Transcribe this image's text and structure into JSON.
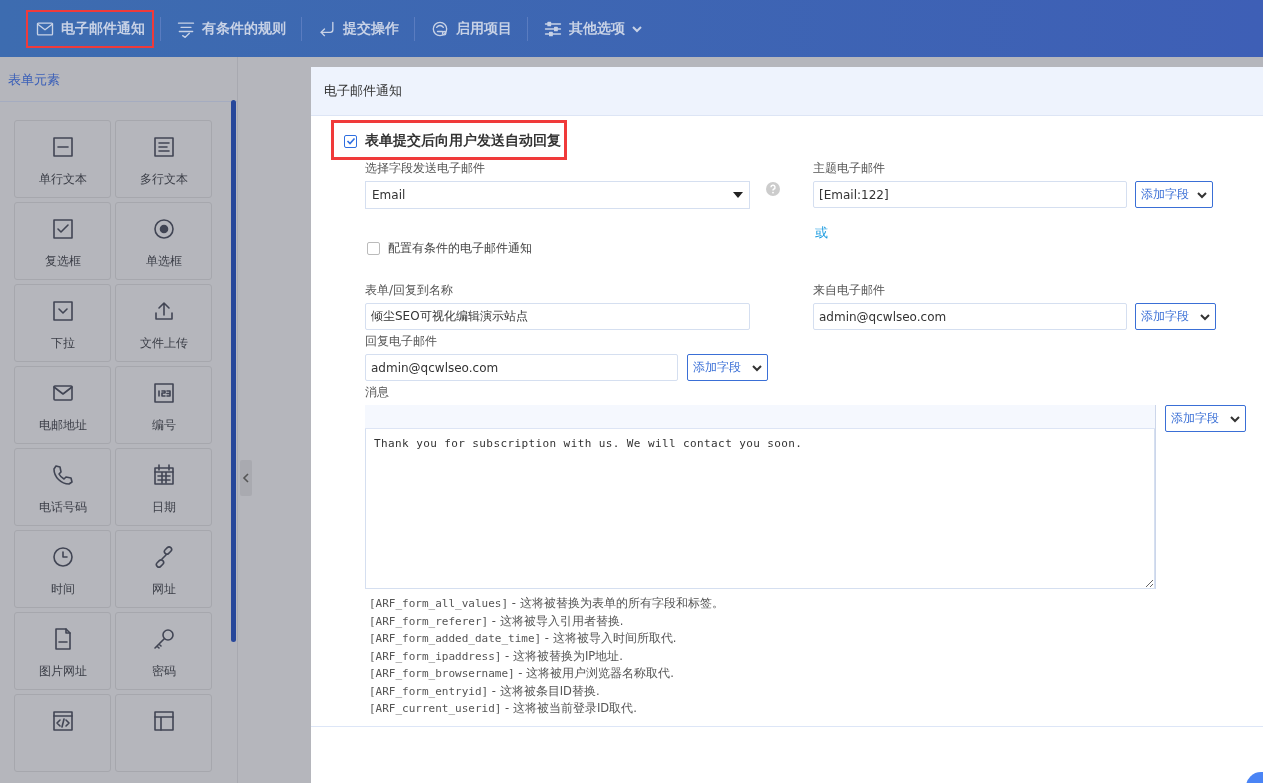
{
  "toolbar": {
    "items": [
      {
        "label": "电子邮件通知",
        "kind": "envelope",
        "selected": true,
        "dropdown": false
      },
      {
        "label": "有条件的规则",
        "kind": "filter-check",
        "selected": false,
        "dropdown": false
      },
      {
        "label": "提交操作",
        "kind": "enter-arrow",
        "selected": false,
        "dropdown": false
      },
      {
        "label": "启用项目",
        "kind": "badge",
        "selected": false,
        "dropdown": false
      },
      {
        "label": "其他选项",
        "kind": "sliders",
        "selected": false,
        "dropdown": true
      }
    ]
  },
  "sidebar": {
    "title": "表单元素",
    "tiles": [
      {
        "label": "单行文本",
        "kind": "text-line"
      },
      {
        "label": "多行文本",
        "kind": "textarea"
      },
      {
        "label": "复选框",
        "kind": "checkbox"
      },
      {
        "label": "单选框",
        "kind": "radio"
      },
      {
        "label": "下拉",
        "kind": "dropdown"
      },
      {
        "label": "文件上传",
        "kind": "upload"
      },
      {
        "label": "电邮地址",
        "kind": "envelope"
      },
      {
        "label": "编号",
        "kind": "number"
      },
      {
        "label": "电话号码",
        "kind": "phone"
      },
      {
        "label": "日期",
        "kind": "calendar"
      },
      {
        "label": "时间",
        "kind": "clock"
      },
      {
        "label": "网址",
        "kind": "link"
      },
      {
        "label": "图片网址",
        "kind": "file"
      },
      {
        "label": "密码",
        "kind": "key"
      },
      {
        "kind": "code"
      },
      {
        "kind": "layout"
      }
    ]
  },
  "dialog": {
    "title": "电子邮件通知",
    "auto_reply": {
      "label": "表单提交后向用户发送自动回复",
      "checked": true,
      "highlighted": true
    },
    "send_field": {
      "label": "选择字段发送电子邮件",
      "value": "Email"
    },
    "subject": {
      "label": "主题电子邮件",
      "value": "[Email:122]",
      "button": "添加字段"
    },
    "or_text": "或",
    "conditional": {
      "label": "配置有条件的电子邮件通知",
      "checked": false
    },
    "from_name": {
      "label": "表单/回复到名称",
      "value": "倾尘SEO可视化编辑演示站点"
    },
    "from_email": {
      "label": "来自电子邮件",
      "value": "admin@qcwlseo.com",
      "button": "添加字段"
    },
    "reply_to": {
      "label": "回复电子邮件",
      "value": "admin@qcwlseo.com",
      "button": "添加字段"
    },
    "message": {
      "label": "消息",
      "value": "Thank you for subscription with us. We will contact you soon.",
      "button": "添加字段"
    },
    "shortcodes": [
      {
        "code": "[ARF_form_all_values]",
        "description": "- 这将被替换为表单的所有字段和标签。"
      },
      {
        "code": "[ARF_form_referer]",
        "description": "- 这将被导入引用者替换."
      },
      {
        "code": "[ARF_form_added_date_time]",
        "description": "- 这将被导入时间所取代."
      },
      {
        "code": "[ARF_form_ipaddress]",
        "description": "- 这将被替换为IP地址."
      },
      {
        "code": "[ARF_form_browsername]",
        "description": "- 这将被用户浏览器名称取代."
      },
      {
        "code": "[ARF_form_entryid]",
        "description": "- 这将被条目ID替换."
      },
      {
        "code": "[ARF_current_userid]",
        "description": "- 这将被当前登录ID取代."
      }
    ]
  }
}
